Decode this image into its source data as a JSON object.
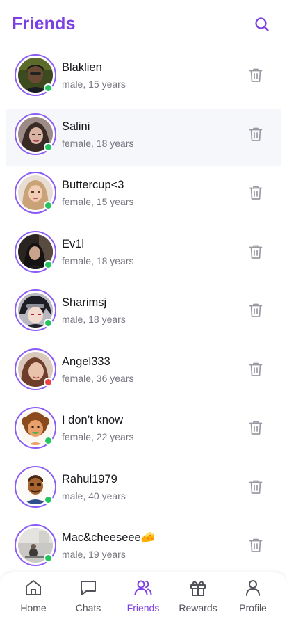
{
  "header": {
    "title": "Friends",
    "search_icon": "search-icon"
  },
  "colors": {
    "accent": "#7b3fe4",
    "online": "#22c55e",
    "offline": "#ef4444",
    "muted": "#767680"
  },
  "friends": [
    {
      "name": "Blaklien",
      "meta": "male, 15 years",
      "status": "online",
      "avatar_icon": "photo-avatar"
    },
    {
      "name": "Salini",
      "meta": "female, 18 years",
      "status": "online",
      "avatar_icon": "photo-avatar"
    },
    {
      "name": "Buttercup<3",
      "meta": "female, 15 years",
      "status": "online",
      "avatar_icon": "photo-avatar"
    },
    {
      "name": "Ev1l",
      "meta": "female, 18 years",
      "status": "online",
      "avatar_icon": "photo-avatar"
    },
    {
      "name": "Sharimsj",
      "meta": "male, 18 years",
      "status": "online",
      "avatar_icon": "anime-avatar"
    },
    {
      "name": "Angel333",
      "meta": "female, 36 years",
      "status": "offline",
      "avatar_icon": "photo-avatar"
    },
    {
      "name": "I don’t know",
      "meta": "female, 22 years",
      "status": "online",
      "avatar_icon": "cartoon-avatar"
    },
    {
      "name": "Rahul1979",
      "meta": "male, 40 years",
      "status": "online",
      "avatar_icon": "cartoon-avatar"
    },
    {
      "name": "Mac&cheeseee🧀",
      "meta": "male, 19 years",
      "status": "online",
      "avatar_icon": "photo-avatar"
    }
  ],
  "nav": {
    "items": [
      {
        "label": "Home",
        "icon": "home-icon",
        "active": false
      },
      {
        "label": "Chats",
        "icon": "chat-icon",
        "active": false
      },
      {
        "label": "Friends",
        "icon": "friends-icon",
        "active": true
      },
      {
        "label": "Rewards",
        "icon": "gift-icon",
        "active": false
      },
      {
        "label": "Profile",
        "icon": "profile-icon",
        "active": false
      }
    ]
  }
}
